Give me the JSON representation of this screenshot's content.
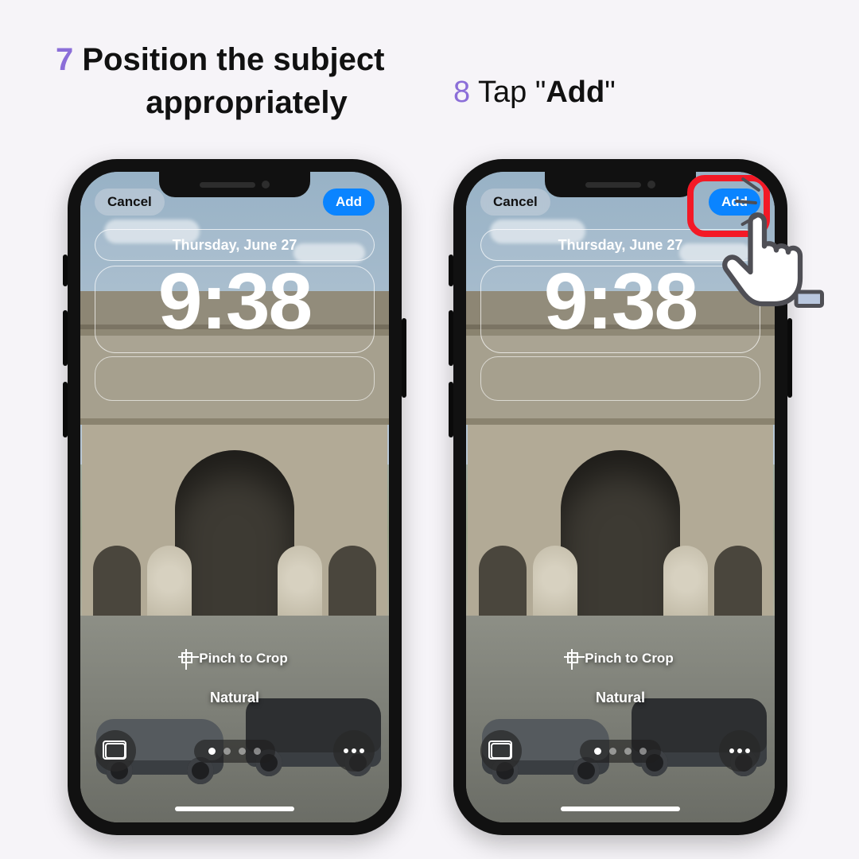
{
  "steps": {
    "s7": {
      "num": "7",
      "line1": "Position the subject",
      "line2": "appropriately"
    },
    "s8": {
      "num": "8",
      "prefix": "Tap ",
      "quote_open": "\"",
      "add": "Add",
      "quote_close": "\""
    }
  },
  "lockscreen": {
    "cancel": "Cancel",
    "add": "Add",
    "date": "Thursday, June 27",
    "time": "9:38",
    "pinch": "Pinch to Crop",
    "filter": "Natural"
  }
}
